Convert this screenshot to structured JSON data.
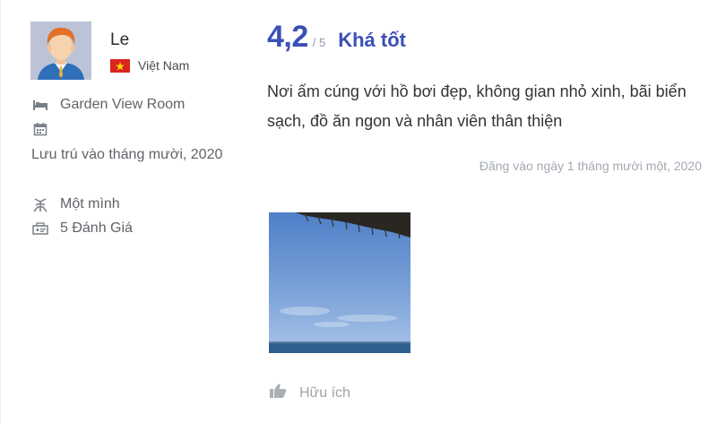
{
  "reviewer": {
    "name": "Le",
    "country": "Việt Nam",
    "room_type": "Garden View Room",
    "stay_date": "Lưu trú vào tháng mười, 2020",
    "traveler_type": "Một mình",
    "review_count": "5 Đánh Giá"
  },
  "review": {
    "score": "4,2",
    "score_max": "/ 5",
    "rating_label": "Khá tốt",
    "text": "Nơi ấm cúng với hồ bơi đẹp, không gian nhỏ xinh, bãi biển sạch, đồ ăn ngon và nhân viên thân thiện",
    "posted_date": "Đăng vào ngày 1 tháng mười một, 2020",
    "helpful_label": "Hữu ích"
  },
  "icons": {
    "room": "bed-icon",
    "stay": "calendar-icon",
    "traveler": "solo-traveler-icon",
    "reviews": "review-count-icon",
    "helpful": "thumbs-up-icon",
    "flag": "vietnam-flag-icon"
  },
  "colors": {
    "accent": "#3b4fb6",
    "muted_text": "#5f6368",
    "posted_text": "#a3a9b3",
    "flag_red": "#da251d",
    "flag_star": "#ffde00"
  }
}
